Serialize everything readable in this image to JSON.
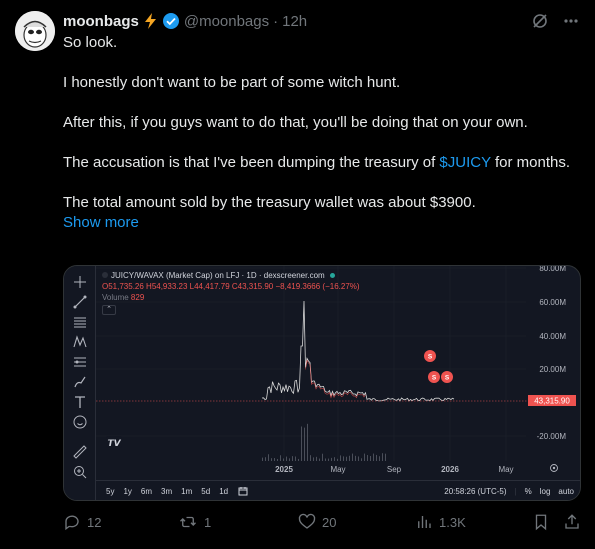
{
  "author": {
    "name": "moonbags",
    "handle": "@moonbags",
    "time": "12h",
    "separator": "·"
  },
  "body": {
    "line1": "So look.",
    "line2": "I honestly don't want to be part of some witch hunt.",
    "line3": "After this, if you guys want to do that, you'll be doing that on your own.",
    "line4_pre": "The accusation is that I've been dumping the treasury of ",
    "line4_cashtag": "$JUICY",
    "line4_post": " for months.",
    "line5": "The total amount sold by the treasury wallet was about $3900.",
    "show_more": "Show more"
  },
  "chart": {
    "pair": "JUICY/WAVAX (Market Cap) on LFJ · 1D · dexscreener.com",
    "ohlc": "O51,735.26 H54,933.23 L44,417.79 C43,315.90 −8,419.3666 (−16.27%)",
    "volume_label": "Volume",
    "volume_value": "829",
    "price_tag": "43,315.90",
    "y_ticks": [
      "80.00M",
      "60.00M",
      "40.00M",
      "20.00M",
      "-20.00M"
    ],
    "x_ticks": [
      "2025",
      "May",
      "Sep",
      "2026",
      "May"
    ],
    "ranges": [
      "5y",
      "1y",
      "6m",
      "3m",
      "1m",
      "5d",
      "1d"
    ],
    "clock": "20:58:26 (UTC-5)",
    "pct": "%",
    "log": "log",
    "auto": "auto",
    "marker": "S",
    "colors": {
      "down": "#ef5350",
      "up": "#26a69a",
      "bg": "#131722"
    }
  },
  "chart_data": {
    "type": "line",
    "title": "JUICY/WAVAX (Market Cap) on LFJ · 1D · dexscreener.com",
    "x": [
      "2025",
      "May",
      "Sep",
      "2026",
      "May"
    ],
    "y_ticks": [
      "80.00M",
      "60.00M",
      "40.00M",
      "20.00M",
      "-20.00M"
    ],
    "last_value": "43,315.90"
  },
  "actions": {
    "replies": "12",
    "reposts": "1",
    "likes": "20",
    "views": "1.3K"
  }
}
